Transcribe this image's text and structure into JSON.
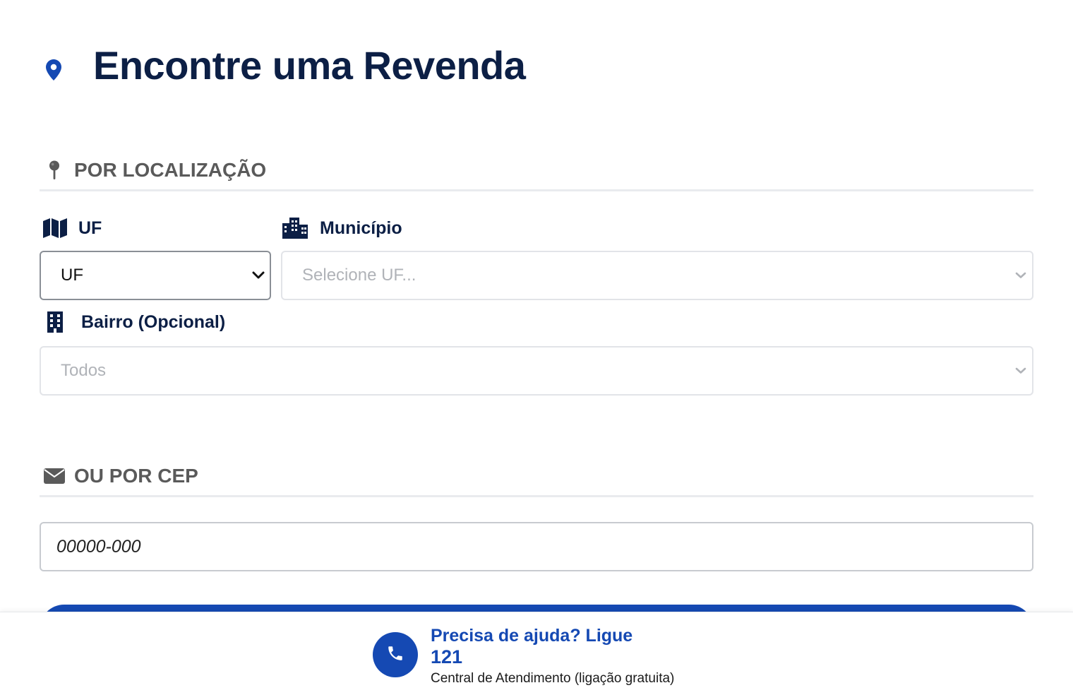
{
  "header": {
    "title": "Encontre uma Revenda",
    "icon": "map-marker-icon"
  },
  "location_section": {
    "title": "POR LOCALIZAÇÃO",
    "icon": "pin-icon",
    "uf": {
      "label": "UF",
      "icon": "map-icon",
      "selected": "UF"
    },
    "municipio": {
      "label": "Município",
      "icon": "city-icon",
      "selected": "Selecione UF..."
    },
    "bairro": {
      "label": "Bairro (Opcional)",
      "icon": "building-icon",
      "selected": "Todos"
    }
  },
  "cep_section": {
    "title": "OU POR CEP",
    "icon": "envelope-icon",
    "placeholder": "00000-000"
  },
  "help": {
    "title": "Precisa de ajuda? Ligue",
    "number": "121",
    "subtitle": "Central de Atendimento (ligação gratuita)",
    "icon": "phone-icon"
  },
  "colors": {
    "primary": "#1549b3",
    "heading": "#0c1f45",
    "section_label": "#5a5a5a"
  }
}
